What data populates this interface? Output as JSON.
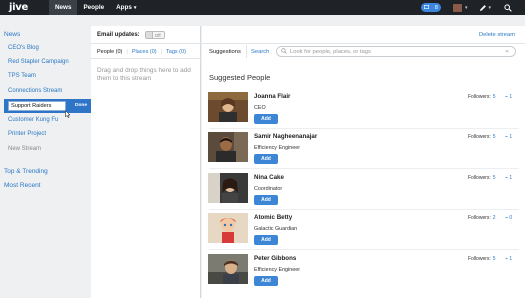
{
  "nav": {
    "logo": "jive",
    "items": [
      {
        "label": "News",
        "active": true
      },
      {
        "label": "People",
        "active": false
      },
      {
        "label": "Apps",
        "active": false
      }
    ],
    "apps_caret": "▾",
    "notification_count": "8"
  },
  "sidebar": {
    "items": [
      {
        "label": "News",
        "kind": "section"
      },
      {
        "label": "CEO's Blog",
        "kind": "link"
      },
      {
        "label": "Red Stapler Campaign",
        "kind": "link"
      },
      {
        "label": "TPS Team",
        "kind": "link"
      },
      {
        "label": "Connections Stream",
        "kind": "link"
      },
      {
        "label": "Customer Kung Fu",
        "kind": "link"
      },
      {
        "label": "Printer Project",
        "kind": "link"
      },
      {
        "label": "New Stream",
        "kind": "muted"
      },
      {
        "label": "Top & Trending",
        "kind": "section"
      },
      {
        "label": "Most Recent",
        "kind": "section"
      }
    ],
    "edit_value": "Support Raiders",
    "done_label": "Done"
  },
  "stream": {
    "email_label": "Email updates:",
    "toggle_label": "Off",
    "tabs": [
      {
        "label": "People (0)",
        "active": true
      },
      {
        "label": "Places (0)",
        "active": false
      },
      {
        "label": "Tags (0)",
        "active": false
      }
    ],
    "drop_hint": "Drag and drop things here to add them to this stream"
  },
  "main": {
    "delete_label": "Delete stream",
    "tabs": [
      {
        "label": "Suggestions",
        "active": true
      },
      {
        "label": "Search",
        "active": false
      }
    ],
    "search_placeholder": "Look for people, places, or tags",
    "section_title": "Suggested People",
    "add_label": "Add",
    "followers_label": "Followers:",
    "people": [
      {
        "name": "Joanna Flair",
        "title": "CEO",
        "followers": "5",
        "trend": "1",
        "photo_bg": "#6b4a2e"
      },
      {
        "name": "Samir Nagheenanajar",
        "title": "Efficiency Engineer",
        "followers": "5",
        "trend": "1",
        "photo_bg": "#5a4b3c"
      },
      {
        "name": "Nina Cake",
        "title": "Coordinator",
        "followers": "5",
        "trend": "1",
        "photo_bg": "#3a3a3a"
      },
      {
        "name": "Atomic Betty",
        "title": "Galactic Guardian",
        "followers": "2",
        "trend": "0",
        "photo_bg": "#e6d8c2"
      },
      {
        "name": "Peter Gibbons",
        "title": "Efficiency Engineer",
        "followers": "5",
        "trend": "1",
        "photo_bg": "#7b7b72"
      }
    ]
  },
  "colors": {
    "accent": "#2b78c5",
    "topbar": "#1f2327",
    "button": "#3d86d6"
  }
}
